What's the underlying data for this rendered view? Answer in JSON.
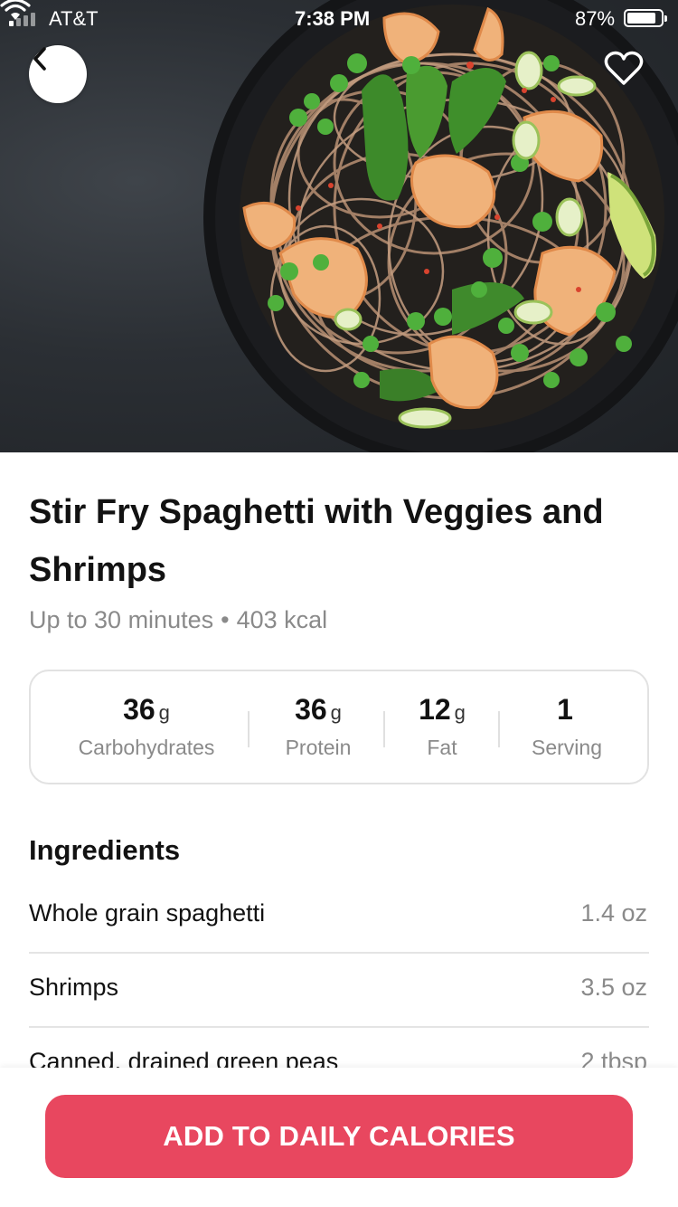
{
  "status_bar": {
    "carrier": "AT&T",
    "time": "7:38 PM",
    "battery_percent_text": "87%",
    "battery_level": 0.87
  },
  "header": {
    "back_icon": "chevron-left-icon",
    "favorite_icon": "heart-outline-icon"
  },
  "recipe": {
    "title": "Stir Fry Spaghetti with Veggies and Shrimps",
    "duration": "Up to 30 minutes",
    "separator": "•",
    "calories": "403 kcal"
  },
  "macros": [
    {
      "value": "36",
      "unit": "g",
      "label": "Carbohydrates"
    },
    {
      "value": "36",
      "unit": "g",
      "label": "Protein"
    },
    {
      "value": "12",
      "unit": "g",
      "label": "Fat"
    },
    {
      "value": "1",
      "unit": "",
      "label": "Serving"
    }
  ],
  "ingredients": {
    "heading": "Ingredients",
    "items": [
      {
        "name": "Whole grain spaghetti",
        "qty": "1.4 oz"
      },
      {
        "name": "Shrimps",
        "qty": "3.5 oz"
      },
      {
        "name": "Canned, drained green peas",
        "qty": "2 tbsp"
      }
    ]
  },
  "cta": {
    "label": "ADD TO DAILY CALORIES"
  },
  "colors": {
    "accent": "#e8475f",
    "muted_text": "#8a8a8a",
    "border": "#e2e2e2"
  }
}
